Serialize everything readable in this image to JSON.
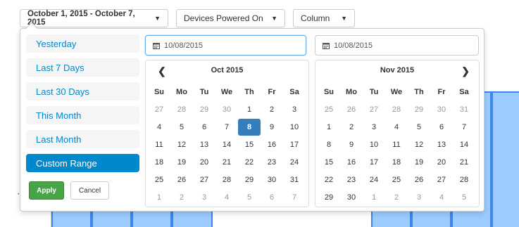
{
  "toolbar": {
    "range_label": "October 1, 2015 - October 7, 2015",
    "series_label": "Devices Powered On",
    "type_label": "Column"
  },
  "chart_bg": {
    "axis_label": "evi"
  },
  "picker": {
    "ranges": [
      {
        "label": "Yesterday",
        "active": false
      },
      {
        "label": "Last 7 Days",
        "active": false
      },
      {
        "label": "Last 30 Days",
        "active": false
      },
      {
        "label": "This Month",
        "active": false
      },
      {
        "label": "Last Month",
        "active": false
      },
      {
        "label": "Custom Range",
        "active": true
      }
    ],
    "apply_label": "Apply",
    "cancel_label": "Cancel",
    "start_value": "10/08/2015",
    "end_value": "10/08/2015",
    "weekdays": [
      "Su",
      "Mo",
      "Tu",
      "We",
      "Th",
      "Fr",
      "Sa"
    ],
    "left_calendar": {
      "month": "Oct 2015",
      "selected": "8",
      "rows": [
        [
          "27",
          "28",
          "29",
          "30",
          "1",
          "2",
          "3"
        ],
        [
          "4",
          "5",
          "6",
          "7",
          "8",
          "9",
          "10"
        ],
        [
          "11",
          "12",
          "13",
          "14",
          "15",
          "16",
          "17"
        ],
        [
          "18",
          "19",
          "20",
          "21",
          "22",
          "23",
          "24"
        ],
        [
          "25",
          "26",
          "27",
          "28",
          "29",
          "30",
          "31"
        ],
        [
          "1",
          "2",
          "3",
          "4",
          "5",
          "6",
          "7"
        ]
      ],
      "off": [
        [
          0,
          0
        ],
        [
          0,
          1
        ],
        [
          0,
          2
        ],
        [
          0,
          3
        ],
        [
          5,
          0
        ],
        [
          5,
          1
        ],
        [
          5,
          2
        ],
        [
          5,
          3
        ],
        [
          5,
          4
        ],
        [
          5,
          5
        ],
        [
          5,
          6
        ]
      ]
    },
    "right_calendar": {
      "month": "Nov 2015",
      "selected": "",
      "rows": [
        [
          "25",
          "26",
          "27",
          "28",
          "29",
          "30",
          "31"
        ],
        [
          "1",
          "2",
          "3",
          "4",
          "5",
          "6",
          "7"
        ],
        [
          "8",
          "9",
          "10",
          "11",
          "12",
          "13",
          "14"
        ],
        [
          "15",
          "16",
          "17",
          "18",
          "19",
          "20",
          "21"
        ],
        [
          "22",
          "23",
          "24",
          "25",
          "26",
          "27",
          "28"
        ],
        [
          "29",
          "30",
          "1",
          "2",
          "3",
          "4",
          "5"
        ]
      ],
      "off": [
        [
          0,
          0
        ],
        [
          0,
          1
        ],
        [
          0,
          2
        ],
        [
          0,
          3
        ],
        [
          0,
          4
        ],
        [
          0,
          5
        ],
        [
          0,
          6
        ],
        [
          5,
          2
        ],
        [
          5,
          3
        ],
        [
          5,
          4
        ],
        [
          5,
          5
        ],
        [
          5,
          6
        ]
      ]
    }
  },
  "colors": {
    "accent": "#0088cc",
    "apply_green": "#47a447",
    "selected_blue": "#357ebd",
    "bar_fill": "#9ccbff",
    "bar_stroke": "#3c86ee"
  }
}
